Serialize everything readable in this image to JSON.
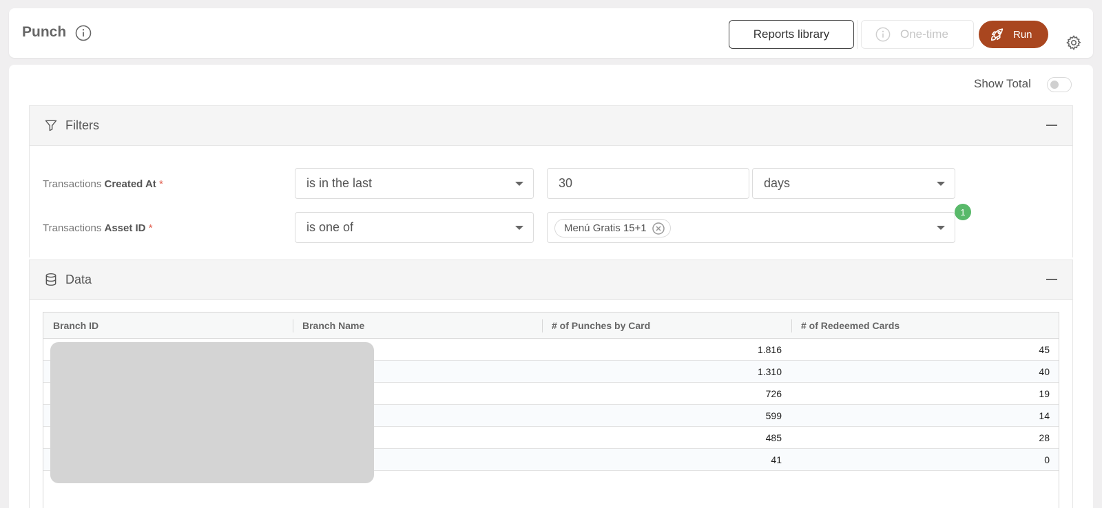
{
  "header": {
    "title": "Punch",
    "reports_library_label": "Reports library",
    "one_time_label": "One-time",
    "run_label": "Run"
  },
  "show_total": {
    "label": "Show Total",
    "enabled": false
  },
  "filters": {
    "title": "Filters",
    "rows": [
      {
        "label_prefix": "Transactions ",
        "label_bold": "Created At",
        "required": "*",
        "operator": "is in the last",
        "value": "30",
        "unit": "days"
      },
      {
        "label_prefix": "Transactions ",
        "label_bold": "Asset ID",
        "required": "*",
        "operator": "is one of",
        "tags": [
          "Menú Gratis 15+1"
        ],
        "selected_count": "1"
      }
    ]
  },
  "data": {
    "title": "Data",
    "columns": [
      "Branch ID",
      "Branch Name",
      "# of Punches by Card",
      "# of Redeemed Cards"
    ],
    "rows": [
      {
        "punches": "1.816",
        "redeemed": "45"
      },
      {
        "punches": "1.310",
        "redeemed": "40"
      },
      {
        "punches": "726",
        "redeemed": "19"
      },
      {
        "punches": "599",
        "redeemed": "14"
      },
      {
        "punches": "485",
        "redeemed": "28"
      },
      {
        "punches": "41",
        "redeemed": "0"
      }
    ]
  },
  "colors": {
    "run_button": "#a9461f",
    "badge": "#59b96a",
    "required": "#e05a4a"
  }
}
